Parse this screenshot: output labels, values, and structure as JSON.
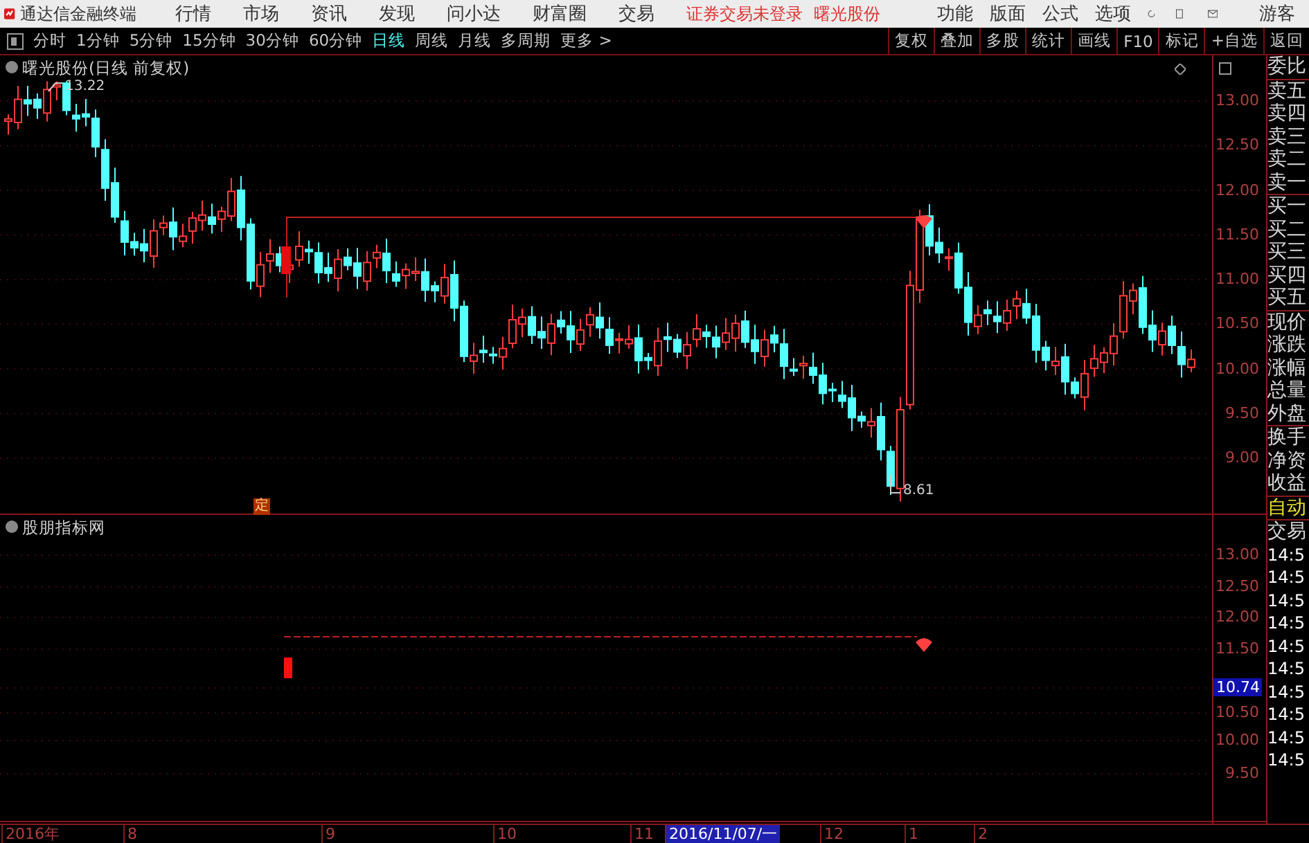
{
  "app_bar": {
    "title": "通达信金融终端",
    "menu": [
      "行情",
      "市场",
      "资讯",
      "发现",
      "问小达",
      "财富圈",
      "交易"
    ],
    "status": "证券交易未登录",
    "stock": "曙光股份",
    "right_menu": [
      "功能",
      "版面",
      "公式",
      "选项"
    ],
    "user": "游客"
  },
  "periods": [
    {
      "label": "分时",
      "selected": false
    },
    {
      "label": "1分钟",
      "selected": false
    },
    {
      "label": "5分钟",
      "selected": false
    },
    {
      "label": "15分钟",
      "selected": false
    },
    {
      "label": "30分钟",
      "selected": false
    },
    {
      "label": "60分钟",
      "selected": false
    },
    {
      "label": "日线",
      "selected": true
    },
    {
      "label": "周线",
      "selected": false
    },
    {
      "label": "月线",
      "selected": false
    },
    {
      "label": "多周期",
      "selected": false
    },
    {
      "label": "更多 >",
      "selected": false
    }
  ],
  "tools": [
    "复权",
    "叠加",
    "多股",
    "统计",
    "画线",
    "F10",
    "标记",
    "+自选",
    "返回"
  ],
  "main_chart": {
    "title": "曙光股份(日线 前复权)",
    "high_label": "13.22",
    "low_label": "8.61",
    "marker": "定",
    "axis": [
      "13.00",
      "12.50",
      "12.00",
      "11.50",
      "11.00",
      "10.50",
      "10.00",
      "9.50",
      "9.00"
    ]
  },
  "indicator_chart": {
    "title": "股朋指标网",
    "axis": [
      {
        "label": "13.00",
        "kind": "tick"
      },
      {
        "label": "12.50",
        "kind": "tick"
      },
      {
        "label": "12.00",
        "kind": "tick"
      },
      {
        "label": "11.50",
        "kind": "tick"
      },
      {
        "label": "10.74",
        "kind": "current"
      },
      {
        "label": "10.50",
        "kind": "tick"
      },
      {
        "label": "10.00",
        "kind": "tick"
      },
      {
        "label": "9.50",
        "kind": "tick"
      }
    ]
  },
  "quote_panel": {
    "groups": [
      [
        "委比"
      ],
      [
        "卖五",
        "卖四",
        "卖三",
        "卖二",
        "卖一"
      ],
      [
        "买一",
        "买二",
        "买三",
        "买四",
        "买五"
      ],
      [
        "现价",
        "涨跌",
        "涨幅",
        "总量",
        "外盘"
      ],
      [
        "换手",
        "净资",
        "收益"
      ]
    ],
    "mode": "自动",
    "trades_title": "交易",
    "trades": [
      "14:5",
      "14:5",
      "14:5",
      "14:5",
      "14:5",
      "14:5",
      "14:5",
      "14:5",
      "14:5",
      "14:5"
    ]
  },
  "time_axis": [
    {
      "label": "2016年",
      "selected": false
    },
    {
      "label": "8",
      "selected": false
    },
    {
      "label": "9",
      "selected": false
    },
    {
      "label": "10",
      "selected": false
    },
    {
      "label": "11",
      "selected": false
    },
    {
      "label": "2016/11/07/一",
      "selected": true
    },
    {
      "label": "12",
      "selected": false
    },
    {
      "label": "1",
      "selected": false
    },
    {
      "label": "2",
      "selected": false
    }
  ]
}
